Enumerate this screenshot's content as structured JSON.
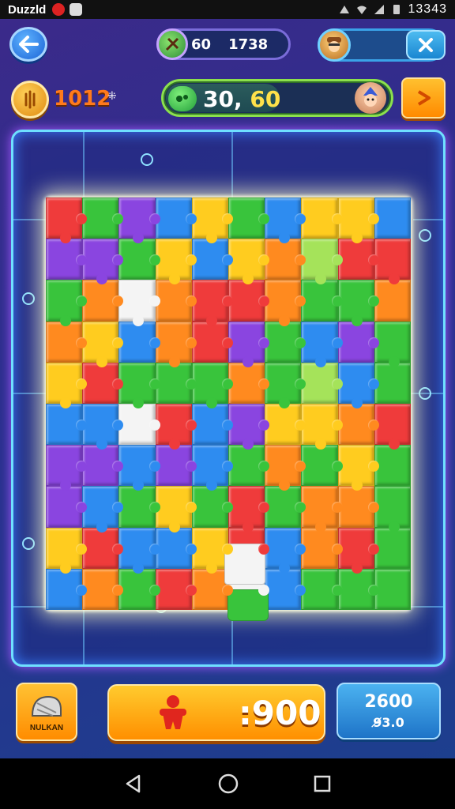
{
  "status_bar": {
    "app_name": "Duzzld",
    "clock": "13343",
    "icons": [
      "notification-icon",
      "app-badge-icon",
      "signal-icon",
      "wifi-icon",
      "cell-icon",
      "battery-icon"
    ]
  },
  "header": {
    "score_left": "60",
    "score_right": "1738",
    "player_avatar": "pirate-avatar",
    "close_icon": "close-icon",
    "back_icon": "back-arrow-icon"
  },
  "resources": {
    "coins": "1012",
    "coins_suffix": "⁜",
    "progress_main": "30,",
    "progress_highlight": "60",
    "progress_fraction": 0.5,
    "wizard_icon": "wizard-avatar",
    "play_icon": "play-icon"
  },
  "bottom": {
    "helmet_label": "NULKAN",
    "main_amount": ":900",
    "stats_top": "2600",
    "stats_bottom": "9̸3.0"
  },
  "colors": {
    "red": "#ef3b3b",
    "orange": "#ff8a1f",
    "yellow": "#ffcc1f",
    "green": "#39c43c",
    "blue": "#2e8cf0",
    "purple": "#8a45e0",
    "white": "#f4f4f4",
    "lime": "#a5e35a",
    "frame": "#6fe0ff",
    "accent_green": "#8be04d"
  },
  "puzzle": {
    "rows": [
      [
        "r",
        "g",
        "p",
        "b",
        "y",
        "g",
        "b",
        "y",
        "y",
        "b"
      ],
      [
        "p",
        "p",
        "g",
        "y",
        "b",
        "y",
        "o",
        "l",
        "r",
        "r"
      ],
      [
        "g",
        "o",
        "w",
        "o",
        "r",
        "r",
        "o",
        "g",
        "g",
        "o"
      ],
      [
        "o",
        "y",
        "b",
        "o",
        "r",
        "p",
        "g",
        "b",
        "p",
        "g"
      ],
      [
        "y",
        "r",
        "g",
        "g",
        "g",
        "o",
        "g",
        "l",
        "b",
        "g"
      ],
      [
        "b",
        "b",
        "w",
        "r",
        "b",
        "p",
        "y",
        "y",
        "o",
        "r"
      ],
      [
        "p",
        "p",
        "b",
        "p",
        "b",
        "g",
        "o",
        "g",
        "y",
        "g"
      ],
      [
        "p",
        "b",
        "g",
        "y",
        "g",
        "r",
        "g",
        "o",
        "o",
        "g"
      ],
      [
        "y",
        "r",
        "b",
        "b",
        "y",
        "r",
        "b",
        "o",
        "r",
        "g"
      ],
      [
        "b",
        "o",
        "g",
        "r",
        "o",
        "w",
        "b",
        "g",
        "g",
        "g"
      ]
    ]
  }
}
